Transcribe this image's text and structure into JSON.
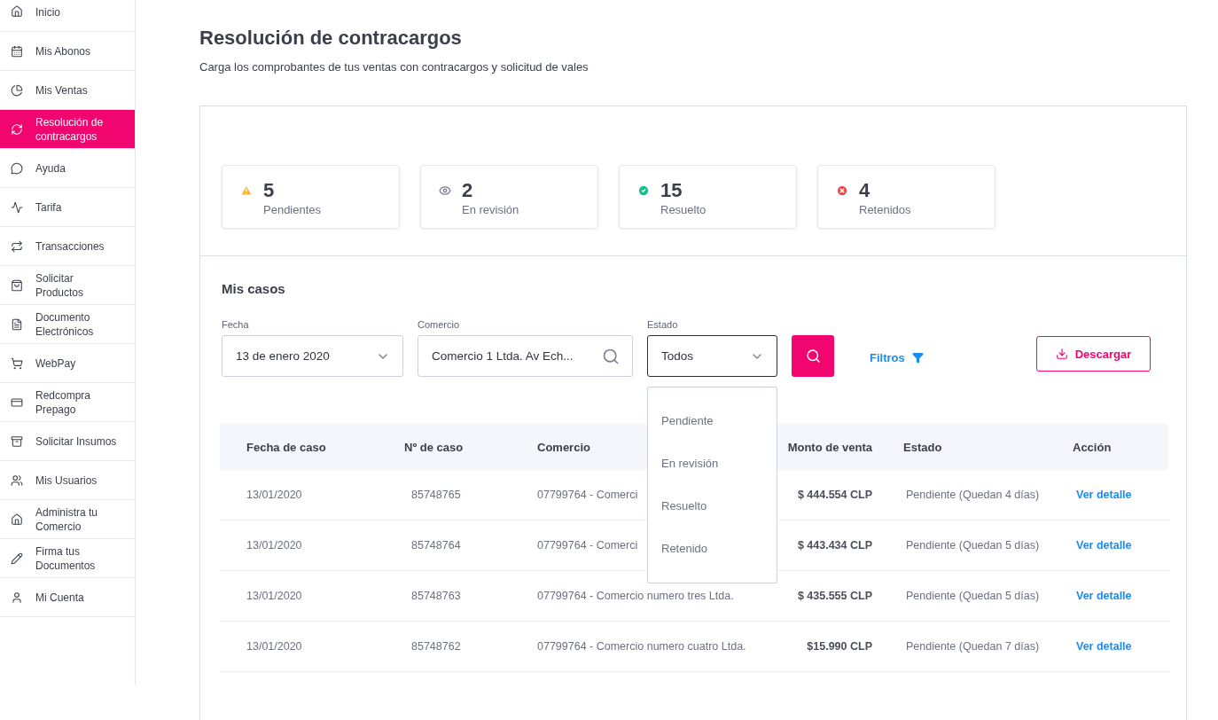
{
  "sidebar": {
    "items": [
      {
        "label": "Inicio",
        "selected": false
      },
      {
        "label": "Mis Abonos",
        "selected": false
      },
      {
        "label": "Mis Ventas",
        "selected": false
      },
      {
        "label": "Resolución de contracargos",
        "selected": true
      },
      {
        "label": "Ayuda",
        "selected": false
      },
      {
        "label": "Tarifa",
        "selected": false
      },
      {
        "label": "Transacciones",
        "selected": false
      },
      {
        "label": "Solicitar Productos",
        "selected": false
      },
      {
        "label": "Documento Electrónicos",
        "selected": false
      },
      {
        "label": "WebPay",
        "selected": false
      },
      {
        "label": "Redcompra Prepago",
        "selected": false
      },
      {
        "label": "Solicitar Insumos",
        "selected": false
      },
      {
        "label": "Mis Usuarios",
        "selected": false
      },
      {
        "label": "Administra tu Comercio",
        "selected": false
      },
      {
        "label": "Firma tus Documentos",
        "selected": false
      },
      {
        "label": "Mi Cuenta",
        "selected": false
      }
    ]
  },
  "page": {
    "title": "Resolución de contracargos",
    "subtitle": "Carga los comprobantes de tus ventas con contracargos y solicitud de vales"
  },
  "stats": [
    {
      "kind": "warning",
      "value": "5",
      "label": "Pendientes"
    },
    {
      "kind": "review",
      "value": "2",
      "label": "En revisión"
    },
    {
      "kind": "resolved",
      "value": "15",
      "label": "Resuelto"
    },
    {
      "kind": "rejected",
      "value": "4",
      "label": "Retenidos"
    }
  ],
  "cases": {
    "title": "Mis casos",
    "filters": {
      "date": {
        "label": "Fecha",
        "value": "13 de enero 2020"
      },
      "store": {
        "label": "Comercio",
        "value": "Comercio 1 Ltda. Av Ech..."
      },
      "status": {
        "label": "Estado",
        "value": "Todos",
        "expanded": true,
        "options": [
          "Pendiente",
          "En revisión",
          "Resuelto",
          "Retenido"
        ]
      }
    },
    "filters_link": "Filtros",
    "download": "Descargar",
    "columns": [
      "Fecha de caso",
      "Nº de caso",
      "Comercio",
      "Monto de venta",
      "Estado",
      "Acción"
    ],
    "rows": [
      [
        "13/01/2020",
        "85748765",
        "07799764 - Comerci",
        "$ 444.554  CLP",
        "Pendiente (Quedan 4 días)",
        "Ver detalle"
      ],
      [
        "13/01/2020",
        "85748764",
        "07799764 - Comerci",
        "$ 443.434  CLP",
        "Pendiente (Quedan 5 días)",
        "Ver detalle"
      ],
      [
        "13/01/2020",
        "85748763",
        "07799764 - Comercio numero tres Ltda.",
        "$ 435.555  CLP",
        "Pendiente (Quedan 5 días)",
        "Ver detalle"
      ],
      [
        "13/01/2020",
        "85748762",
        "07799764 - Comercio numero cuatro Ltda.",
        "$15.990  CLP",
        "Pendiente (Quedan 7 días)",
        "Ver detalle"
      ]
    ]
  }
}
